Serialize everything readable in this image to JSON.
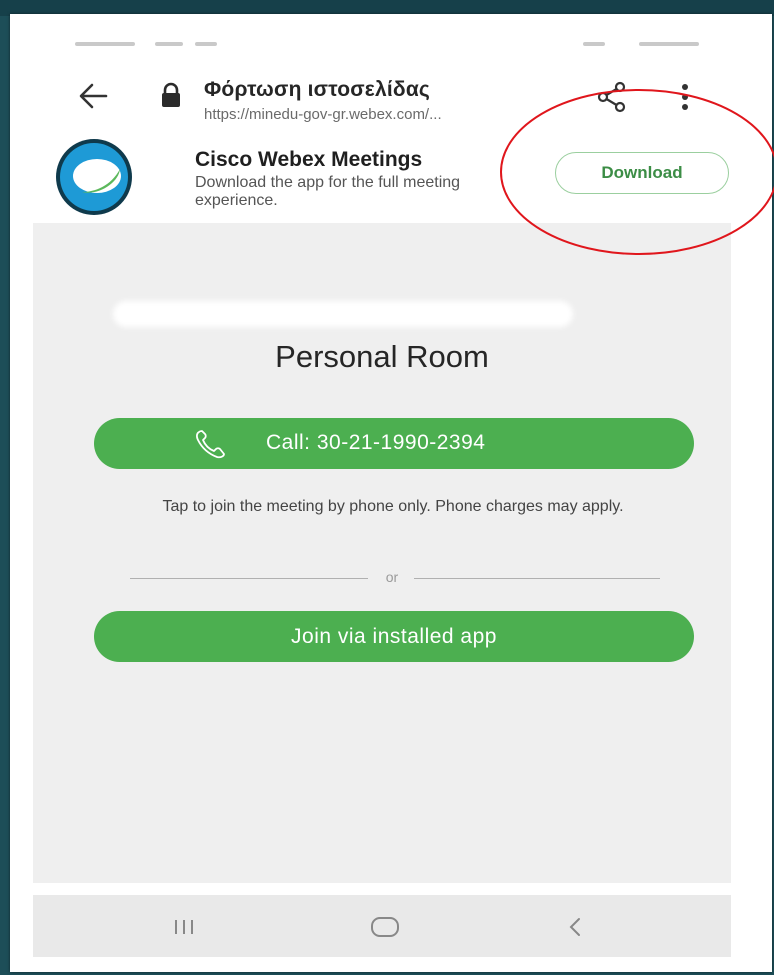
{
  "browser": {
    "page_title": "Φόρτωση ιστοσελίδας",
    "url": "https://minedu-gov-gr.webex.com/..."
  },
  "app_banner": {
    "app_name": "Cisco Webex Meetings",
    "description": "Download the app for the full meeting experience.",
    "download_label": "Download"
  },
  "room": {
    "title": "Personal Room",
    "call_label": "Call: 30-21-1990-2394",
    "call_note": "Tap to join the meeting by phone only. Phone charges may apply.",
    "divider_text": "or",
    "join_label": "Join via installed app"
  },
  "icons": {
    "back": "arrow-left",
    "lock": "lock",
    "share": "share",
    "menu": "vertical-dots",
    "logo": "webex-logo",
    "phone": "phone",
    "nav_recent": "recent-apps",
    "nav_home": "home",
    "nav_back": "chevron-left"
  },
  "colors": {
    "accent_green": "#4caf50",
    "download_text": "#3c8d46",
    "annotation_red": "#e0161c",
    "slide_background": "#1d4e58"
  }
}
